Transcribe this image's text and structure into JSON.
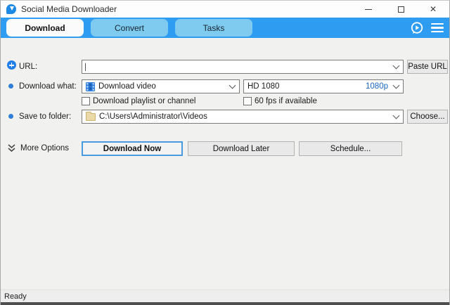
{
  "window": {
    "title": "Social Media Downloader",
    "close_glyph": "✕"
  },
  "tabs": [
    {
      "label": "Download",
      "active": true
    },
    {
      "label": "Convert",
      "active": false
    },
    {
      "label": "Tasks",
      "active": false
    }
  ],
  "form": {
    "url": {
      "label": "URL:",
      "value": "",
      "paste_button": "Paste URL"
    },
    "download_what": {
      "label": "Download what:",
      "selected": "Download video",
      "quality_name": "HD 1080",
      "quality_badge": "1080p",
      "playlist_checkbox": "Download playlist or channel",
      "fps_checkbox": "60 fps if available"
    },
    "save_to": {
      "label": "Save to folder:",
      "value": "C:\\Users\\Administrator\\Videos",
      "choose_button": "Choose..."
    },
    "more_options_label": "More Options",
    "buttons": {
      "download_now": "Download Now",
      "download_later": "Download Later",
      "schedule": "Schedule..."
    }
  },
  "status_bar": {
    "text": "Ready"
  },
  "colors": {
    "tabbar_blue": "#2e9cf0",
    "inactive_tab": "#7fcaef",
    "quality_text": "#1566c0",
    "default_button_border": "#4a9ae0"
  }
}
